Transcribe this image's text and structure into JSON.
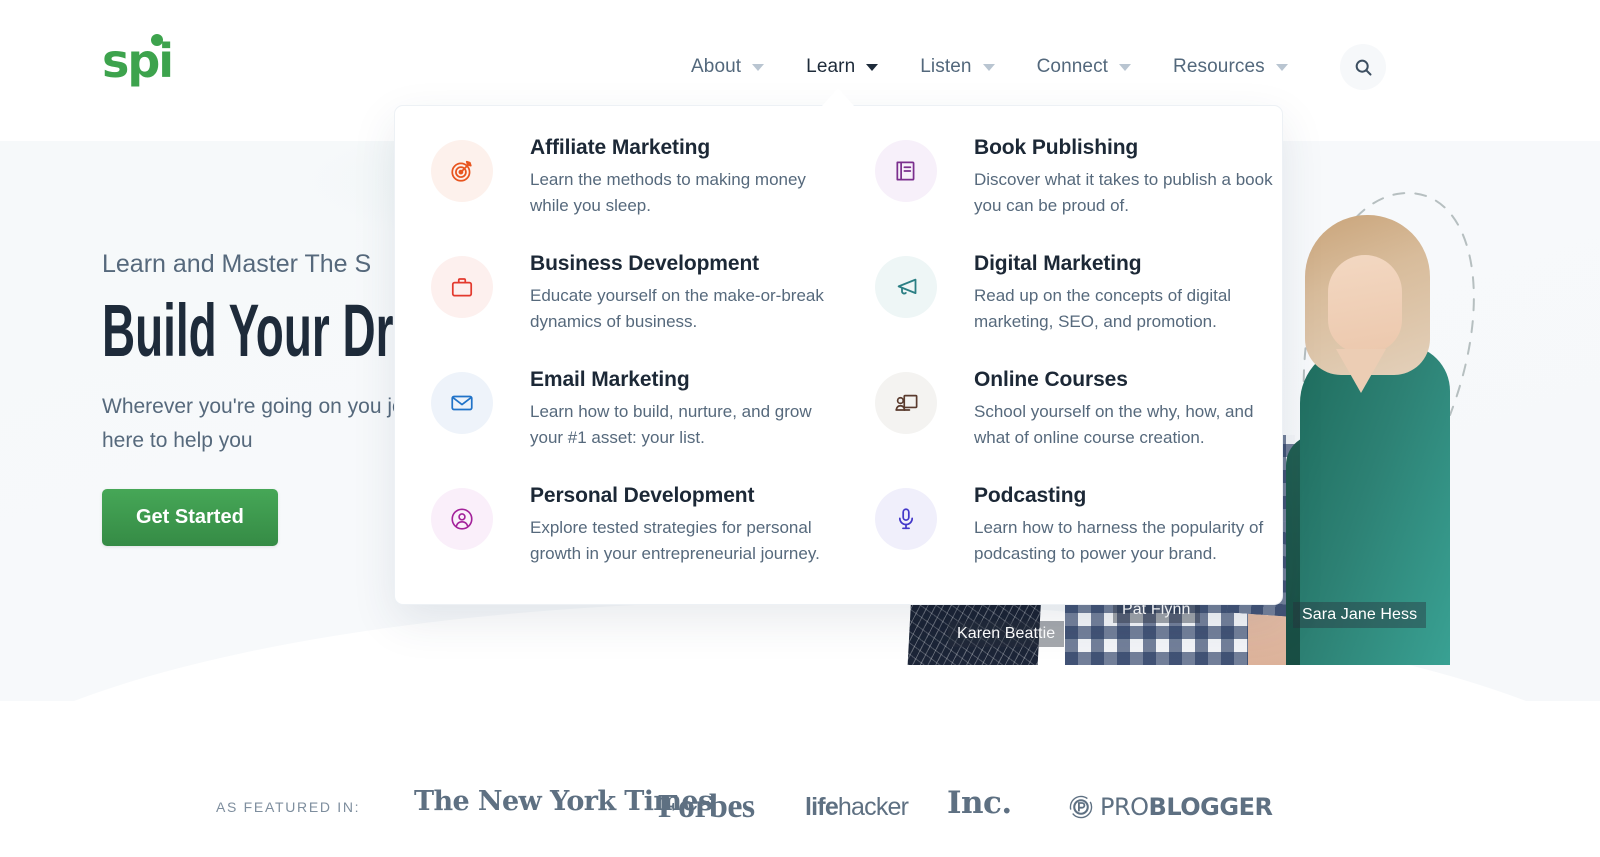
{
  "brand": {
    "logo_text": "spi",
    "logo_color": "#3da34d"
  },
  "nav": {
    "items": [
      {
        "label": "About",
        "active": false
      },
      {
        "label": "Learn",
        "active": true
      },
      {
        "label": "Listen",
        "active": false
      },
      {
        "label": "Connect",
        "active": false
      },
      {
        "label": "Resources",
        "active": false
      }
    ],
    "search_icon": "search-icon"
  },
  "hero": {
    "eyebrow": "Learn and Master The S",
    "title": "Build Your Dre",
    "subtitle": "Wherever you're going on you journey, we're here to help you",
    "cta_label": "Get Started",
    "cta_color": "#3d9a4e"
  },
  "dropdown": {
    "open_for": "Learn",
    "items": [
      {
        "title": "Affiliate Marketing",
        "desc": "Learn the methods to making money while you sleep.",
        "icon": "target-icon",
        "icon_color": "#e8551f",
        "icon_bg": "#fdf1ec"
      },
      {
        "title": "Book Publishing",
        "desc": "Discover what it takes to publish a book you can be proud of.",
        "icon": "book-icon",
        "icon_color": "#7b2f8e",
        "icon_bg": "#f7f0fa"
      },
      {
        "title": "Business Development",
        "desc": "Educate yourself on the make-or-break dynamics of business.",
        "icon": "briefcase-icon",
        "icon_color": "#e33a2e",
        "icon_bg": "#fdf0ee"
      },
      {
        "title": "Digital Marketing",
        "desc": "Read up on the concepts of digital marketing, SEO, and promotion.",
        "icon": "megaphone-icon",
        "icon_color": "#2b7f84",
        "icon_bg": "#eef6f6"
      },
      {
        "title": "Email Marketing",
        "desc": "Learn how to build, nurture, and grow your #1 asset: your list.",
        "icon": "envelope-icon",
        "icon_color": "#2173c8",
        "icon_bg": "#eef3fa"
      },
      {
        "title": "Online Courses",
        "desc": "School yourself on the why, how, and what of online course creation.",
        "icon": "presentation-icon",
        "icon_color": "#5a3b2e",
        "icon_bg": "#f4f3f1"
      },
      {
        "title": "Personal Development",
        "desc": "Explore tested strategies for personal growth in your entrepreneurial journey.",
        "icon": "user-circle-icon",
        "icon_color": "#a3219a",
        "icon_bg": "#faeffa"
      },
      {
        "title": "Podcasting",
        "desc": "Learn how to harness the popularity of podcasting to power your brand.",
        "icon": "microphone-icon",
        "icon_color": "#4338c9",
        "icon_bg": "#f0effb"
      }
    ]
  },
  "people": [
    {
      "name": "Karen Beattie"
    },
    {
      "name": "Pat Flynn"
    },
    {
      "name": "Sara Jane Hess"
    }
  ],
  "featured": {
    "label": "AS FEATURED IN:",
    "logos": [
      {
        "name": "The New York Times"
      },
      {
        "name": "Forbes"
      },
      {
        "name": "lifehacker",
        "bold_part": "life",
        "rest_part": "hacker"
      },
      {
        "name": "Inc."
      },
      {
        "name": "PROBLOGGER",
        "light_part": "PRO",
        "bold_part": "BLOGGER"
      }
    ]
  }
}
